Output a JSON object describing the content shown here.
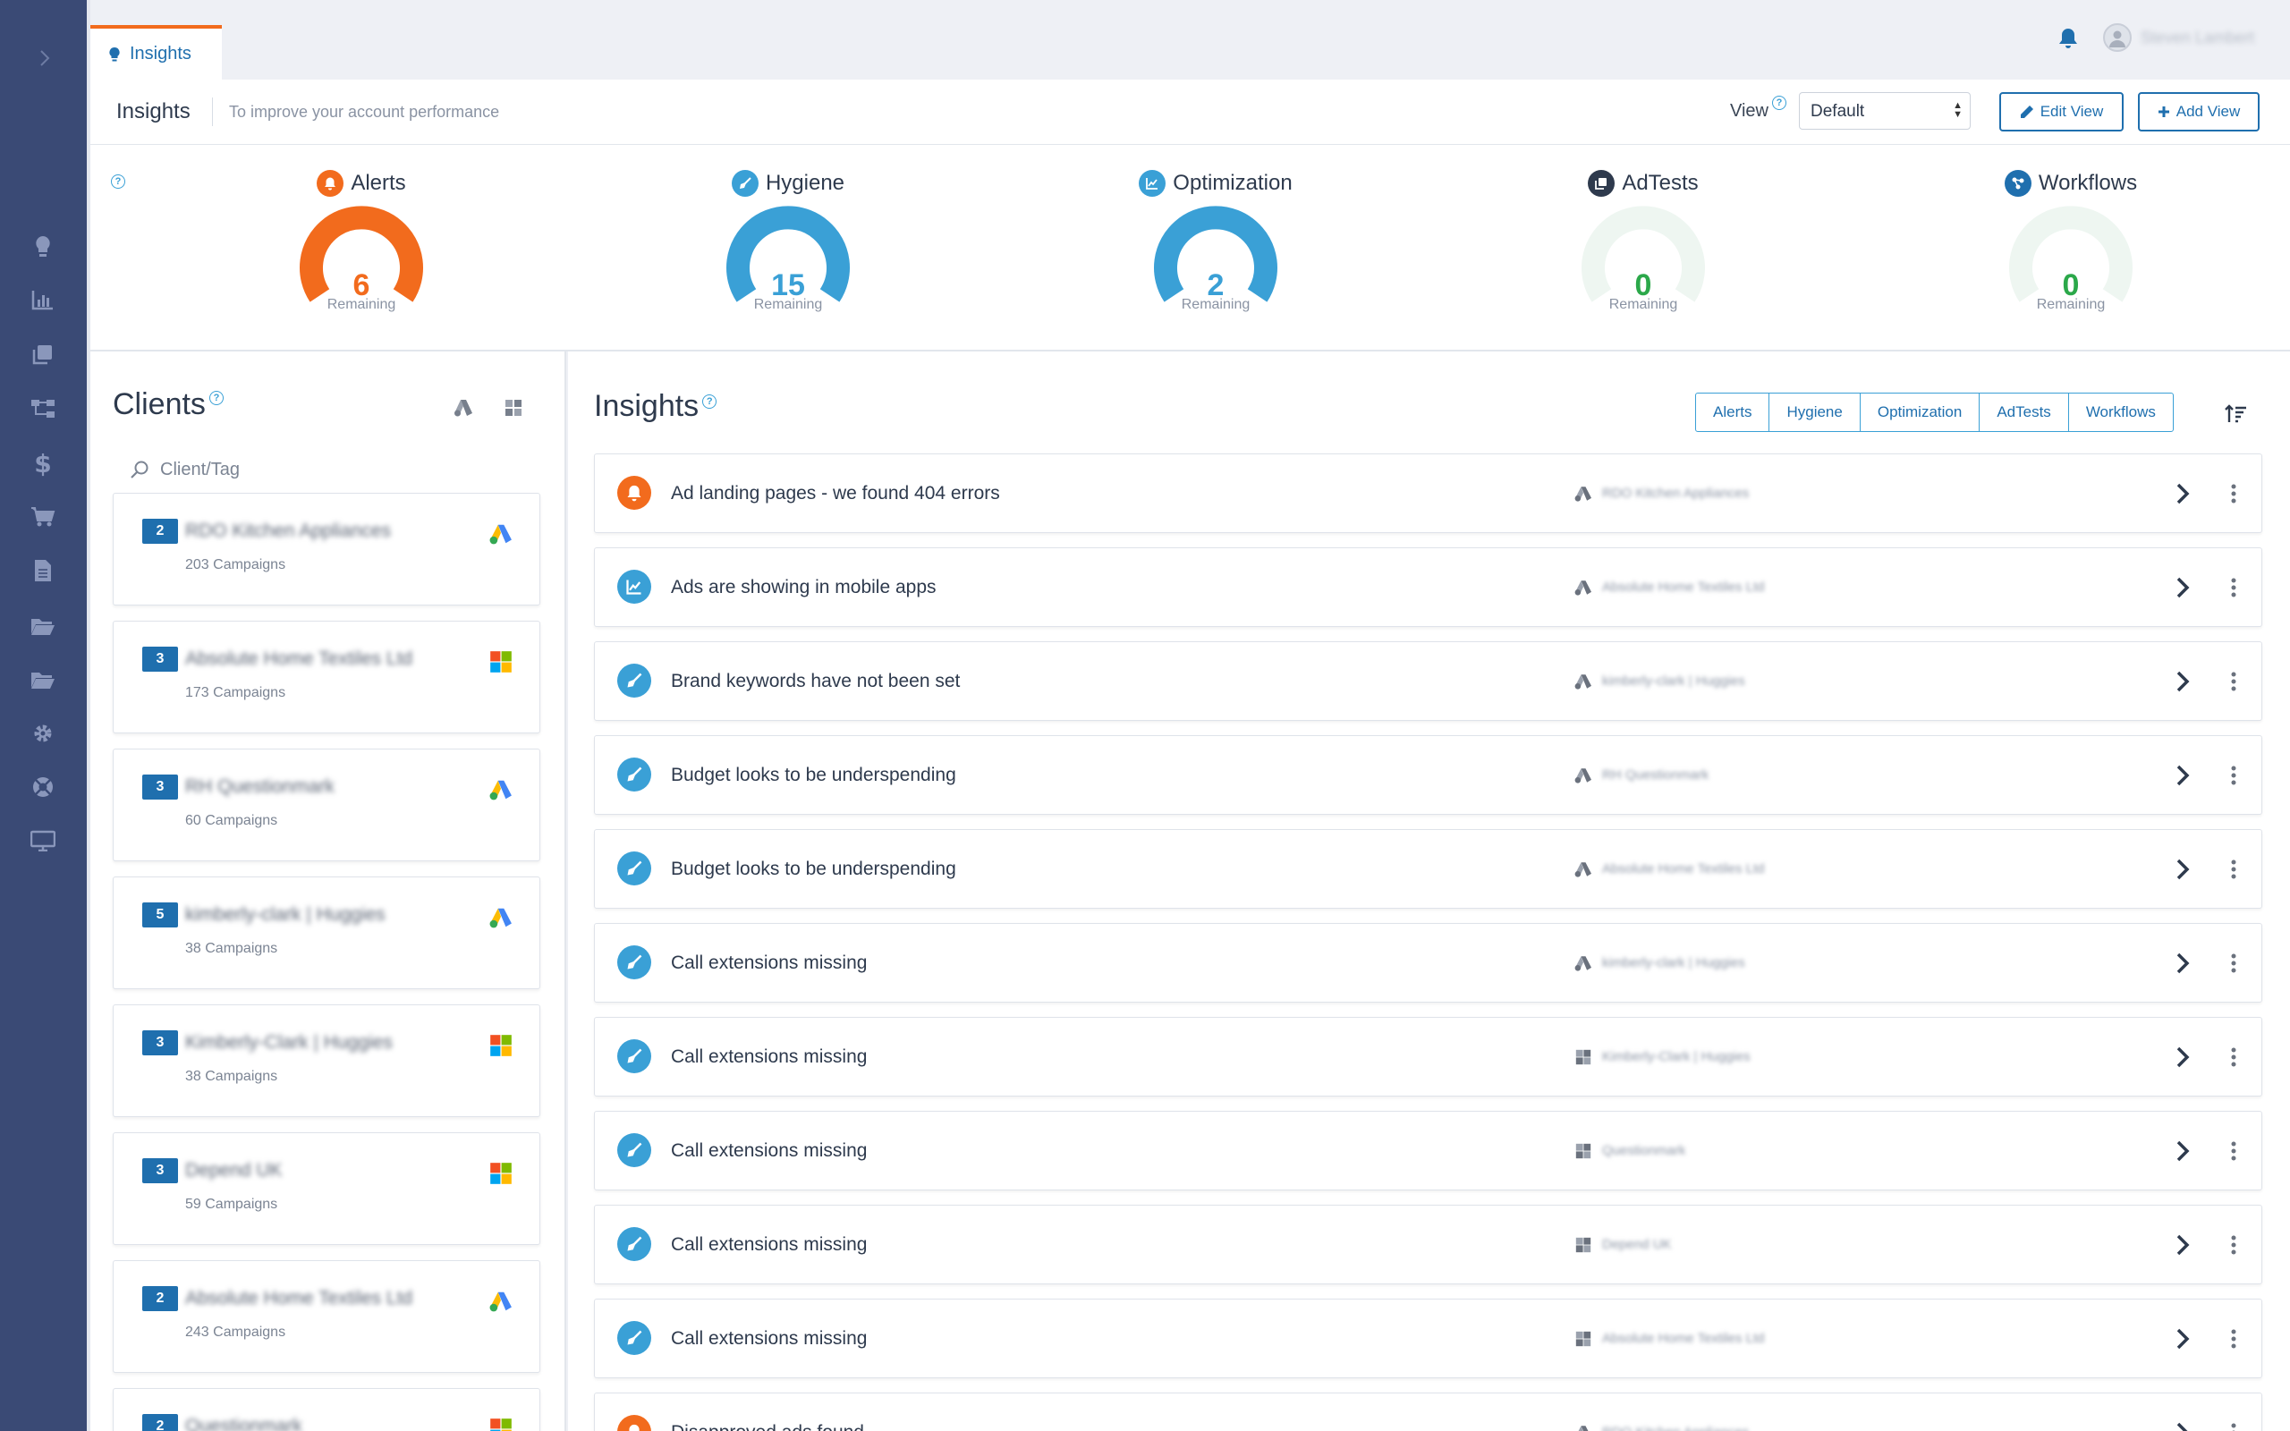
{
  "topbar": {
    "tab_label": "Insights",
    "user_name": "Steven Lambert"
  },
  "header": {
    "title": "Insights",
    "subtitle": "To improve your account performance",
    "view_label": "View",
    "view_selected": "Default",
    "edit_view_label": "Edit View",
    "add_view_label": "Add View"
  },
  "gauges": [
    {
      "label": "Alerts",
      "value": "6",
      "remaining_label": "Remaining",
      "color": "#f26b1d",
      "icon": "bell-icon"
    },
    {
      "label": "Hygiene",
      "value": "15",
      "remaining_label": "Remaining",
      "color": "#3aa0d6",
      "icon": "broom-icon"
    },
    {
      "label": "Optimization",
      "value": "2",
      "remaining_label": "Remaining",
      "color": "#3aa0d6",
      "icon": "trend-chart-icon"
    },
    {
      "label": "AdTests",
      "value": "0",
      "remaining_label": "Remaining",
      "color": "#2ba84a",
      "icon": "copy-icon"
    },
    {
      "label": "Workflows",
      "value": "0",
      "remaining_label": "Remaining",
      "color": "#2ba84a",
      "icon": "workflow-icon"
    }
  ],
  "clients": {
    "title": "Clients",
    "search_placeholder": "Client/Tag",
    "items": [
      {
        "badge": "2",
        "name": "RDO Kitchen Appliances",
        "campaigns": "203 Campaigns",
        "platform": "google-ads"
      },
      {
        "badge": "3",
        "name": "Absolute Home Textiles Ltd",
        "campaigns": "173 Campaigns",
        "platform": "microsoft-ads"
      },
      {
        "badge": "3",
        "name": "RH Questionmark",
        "campaigns": "60 Campaigns",
        "platform": "google-ads"
      },
      {
        "badge": "5",
        "name": "kimberly-clark | Huggies",
        "campaigns": "38 Campaigns",
        "platform": "google-ads"
      },
      {
        "badge": "3",
        "name": "Kimberly-Clark | Huggies",
        "campaigns": "38 Campaigns",
        "platform": "microsoft-ads"
      },
      {
        "badge": "3",
        "name": "Depend UK",
        "campaigns": "59 Campaigns",
        "platform": "microsoft-ads"
      },
      {
        "badge": "2",
        "name": "Absolute Home Textiles Ltd",
        "campaigns": "243 Campaigns",
        "platform": "google-ads"
      },
      {
        "badge": "2",
        "name": "Questionmark",
        "campaigns": "",
        "platform": "microsoft-ads"
      }
    ]
  },
  "insights": {
    "title": "Insights",
    "filters": [
      "Alerts",
      "Hygiene",
      "Optimization",
      "AdTests",
      "Workflows"
    ],
    "rows": [
      {
        "text": "Ad landing pages - we found 404 errors",
        "type": "alert",
        "platform": "google-ads",
        "client": "RDO Kitchen Appliances"
      },
      {
        "text": "Ads are showing in mobile apps",
        "type": "optimization",
        "platform": "google-ads",
        "client": "Absolute Home Textiles Ltd"
      },
      {
        "text": "Brand keywords have not been set",
        "type": "hygiene",
        "platform": "google-ads",
        "client": "kimberly-clark | Huggies"
      },
      {
        "text": "Budget looks to be underspending",
        "type": "hygiene",
        "platform": "google-ads",
        "client": "RH Questionmark"
      },
      {
        "text": "Budget looks to be underspending",
        "type": "hygiene",
        "platform": "google-ads",
        "client": "Absolute Home Textiles Ltd"
      },
      {
        "text": "Call extensions missing",
        "type": "hygiene",
        "platform": "google-ads",
        "client": "kimberly-clark | Huggies"
      },
      {
        "text": "Call extensions missing",
        "type": "hygiene",
        "platform": "microsoft-ads",
        "client": "Kimberly-Clark | Huggies"
      },
      {
        "text": "Call extensions missing",
        "type": "hygiene",
        "platform": "microsoft-ads",
        "client": "Questionmark"
      },
      {
        "text": "Call extensions missing",
        "type": "hygiene",
        "platform": "microsoft-ads",
        "client": "Depend UK"
      },
      {
        "text": "Call extensions missing",
        "type": "hygiene",
        "platform": "microsoft-ads",
        "client": "Absolute Home Textiles Ltd"
      },
      {
        "text": "Disapproved ads found",
        "type": "alert",
        "platform": "google-ads",
        "client": "RDO Kitchen Appliances"
      }
    ]
  },
  "colors": {
    "rail": "#3a4a75",
    "accent_blue": "#1f6fae",
    "light_blue": "#3aa0d6",
    "alert_orange": "#f26b1d",
    "zero_green": "#2ba84a"
  }
}
